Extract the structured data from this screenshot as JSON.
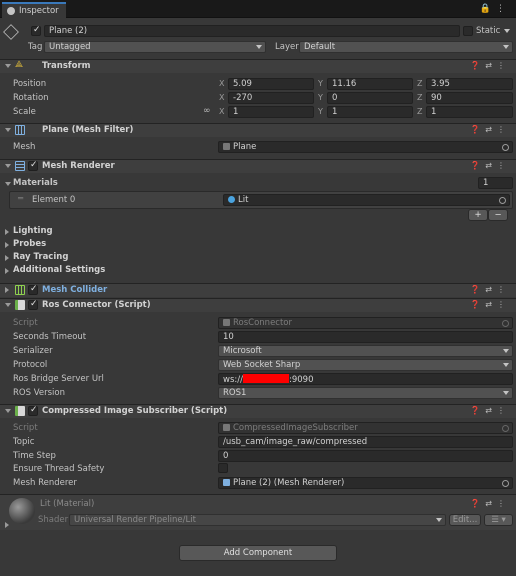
{
  "tab": {
    "label": "Inspector"
  },
  "header": {
    "name": "Plane (2)",
    "static_label": "Static",
    "tag_label": "Tag",
    "tag_value": "Untagged",
    "layer_label": "Layer",
    "layer_value": "Default"
  },
  "transform": {
    "title": "Transform",
    "rows": [
      {
        "label": "Position",
        "x": "5.09",
        "y": "11.16",
        "z": "3.95"
      },
      {
        "label": "Rotation",
        "x": "-270",
        "y": "0",
        "z": "90"
      },
      {
        "label": "Scale",
        "x": "1",
        "y": "1",
        "z": "1"
      }
    ],
    "axis": {
      "x": "X",
      "y": "Y",
      "z": "Z"
    }
  },
  "mesh_filter": {
    "title": "Plane (Mesh Filter)",
    "mesh_label": "Mesh",
    "mesh_value": "Plane"
  },
  "mesh_renderer": {
    "title": "Mesh Renderer",
    "materials_label": "Materials",
    "materials_count": "1",
    "element_label": "Element 0",
    "element_value": "Lit",
    "sections": [
      "Lighting",
      "Probes",
      "Ray Tracing",
      "Additional Settings"
    ]
  },
  "mesh_collider": {
    "title": "Mesh Collider"
  },
  "ros_connector": {
    "title": "Ros Connector (Script)",
    "script_label": "Script",
    "script_value": "RosConnector",
    "timeout_label": "Seconds Timeout",
    "timeout_value": "10",
    "serializer_label": "Serializer",
    "serializer_value": "Microsoft",
    "protocol_label": "Protocol",
    "protocol_value": "Web Socket Sharp",
    "url_label": "Ros Bridge Server Url",
    "url_prefix": "ws://",
    "url_suffix": ":9090",
    "version_label": "ROS Version",
    "version_value": "ROS1"
  },
  "image_sub": {
    "title": "Compressed Image Subscriber (Script)",
    "script_label": "Script",
    "script_value": "CompressedImageSubscriber",
    "topic_label": "Topic",
    "topic_value": "/usb_cam/image_raw/compressed",
    "timestep_label": "Time Step",
    "timestep_value": "0",
    "thread_label": "Ensure Thread Safety",
    "renderer_label": "Mesh Renderer",
    "renderer_value": "Plane (2) (Mesh Renderer)"
  },
  "material": {
    "title": "Lit (Material)",
    "shader_label": "Shader",
    "shader_value": "Universal Render Pipeline/Lit",
    "edit_label": "Edit..."
  },
  "add_component": "Add Component",
  "colors": {
    "accent": "#3a79bb",
    "redaction": "#ff0000",
    "lit": "#4aa3df"
  }
}
